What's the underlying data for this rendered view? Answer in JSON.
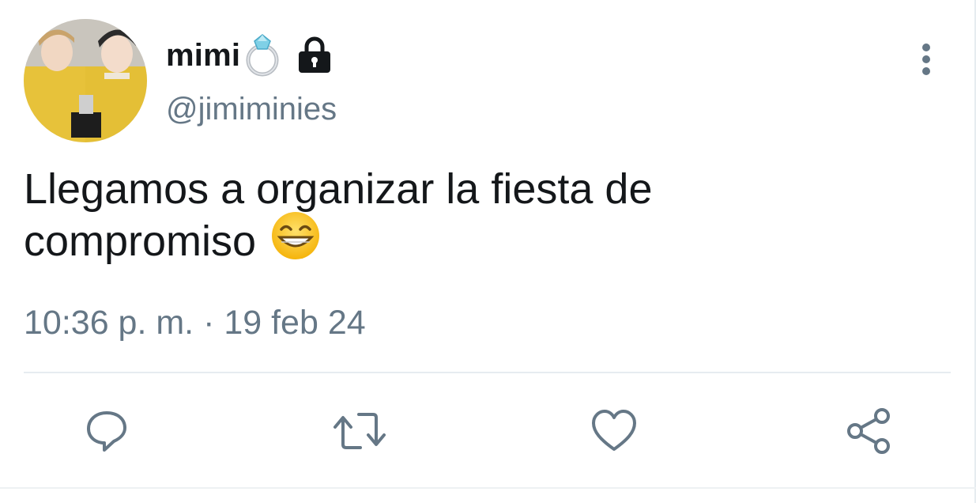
{
  "user": {
    "display_name": "mimi",
    "name_emoji": "ring",
    "protected_icon": "lock-icon",
    "handle": "@jimiminies"
  },
  "tweet": {
    "text_line1": "Llegamos a organizar la fiesta de",
    "text_line2": "compromiso",
    "emoji": "grinning-face-with-smiling-eyes",
    "timestamp": "10:36 p. m. · 19 feb 24"
  },
  "actions": [
    {
      "icon": "reply-icon"
    },
    {
      "icon": "retweet-icon"
    },
    {
      "icon": "like-icon"
    },
    {
      "icon": "share-icon"
    }
  ],
  "menu": {
    "icon": "more-options-icon"
  },
  "colors": {
    "text_primary": "#14171a",
    "text_secondary": "#657786",
    "divider": "#e6ecf0",
    "icon": "#657786"
  }
}
